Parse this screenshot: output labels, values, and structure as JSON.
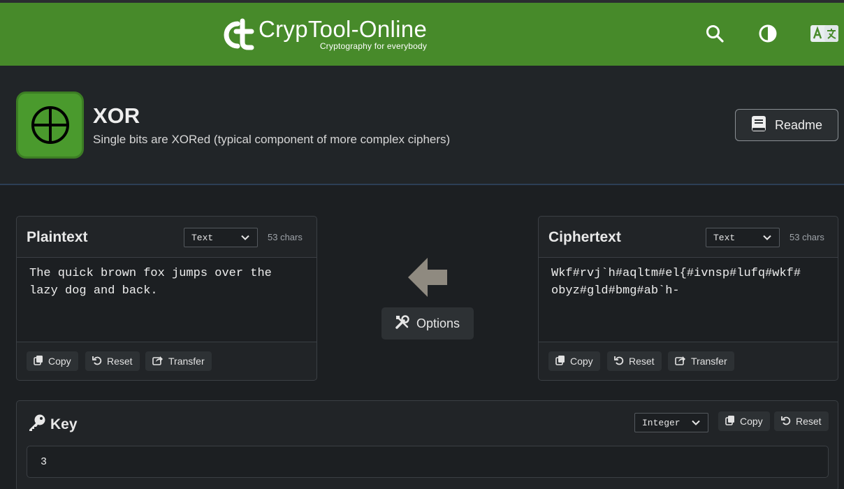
{
  "header": {
    "logo_title": "CrypTool-Online",
    "logo_subtitle": "Cryptography for everybody"
  },
  "tool": {
    "title": "XOR",
    "description": "Single bits are XORed (typical component of more complex ciphers)",
    "readme_label": "Readme"
  },
  "plaintext": {
    "title": "Plaintext",
    "format": "Text",
    "chars": "53 chars",
    "value": "The quick brown fox jumps over the\nlazy dog and back.",
    "copy_label": "Copy",
    "reset_label": "Reset",
    "transfer_label": "Transfer"
  },
  "ciphertext": {
    "title": "Ciphertext",
    "format": "Text",
    "chars": "53 chars",
    "value": "Wkf#rvj`h#aqltm#el{#ivnsp#lufq#wkf#\nobyz#gld#bmg#ab`h-",
    "copy_label": "Copy",
    "reset_label": "Reset",
    "transfer_label": "Transfer"
  },
  "options": {
    "label": "Options"
  },
  "key": {
    "title": "Key",
    "format": "Integer",
    "copy_label": "Copy",
    "reset_label": "Reset",
    "value": "3"
  },
  "icons": {
    "search": "search-icon",
    "contrast": "contrast-icon",
    "language": "language-icon",
    "tool": "xor-circle-icon",
    "readme": "book-icon",
    "arrow": "arrow-left-icon",
    "options": "tools-icon",
    "key": "key-icon"
  },
  "colors": {
    "brand_green": "#478a2a",
    "background": "#1c1f22",
    "panel": "#212427"
  }
}
